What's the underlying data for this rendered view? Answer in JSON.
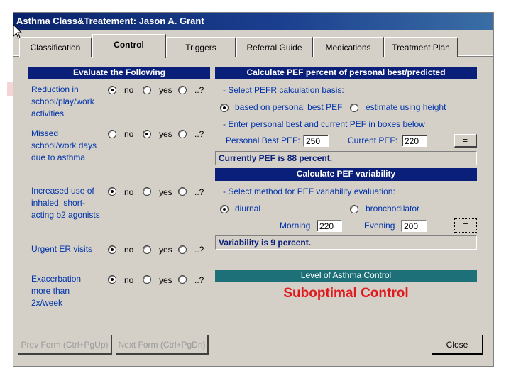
{
  "window": {
    "title": "Asthma Class&Treatement:  Jason A. Grant"
  },
  "tabs": [
    "Classification",
    "Control",
    "Triggers",
    "Referral Guide",
    "Medications",
    "Treatment Plan"
  ],
  "active_tab": "Control",
  "evaluate": {
    "header": "Evaluate the Following",
    "option_labels": {
      "no": "no",
      "yes": "yes",
      "unknown": "..?"
    },
    "items": [
      {
        "label": "Reduction in school/play/work activities",
        "selected": "no"
      },
      {
        "label": "Missed school/work days due to asthma",
        "selected": "yes"
      },
      {
        "label": "Increased use of inhaled, short-acting b2 agonists",
        "selected": "no"
      },
      {
        "label": "Urgent ER visits",
        "selected": "no"
      },
      {
        "label": "Exacerbation more than 2x/week",
        "selected": "no"
      }
    ]
  },
  "pef_percent": {
    "header": "Calculate PEF percent of personal best/predicted",
    "basis_prompt": "- Select PEFR calculation basis:",
    "basis_options": [
      "based on personal best PEF",
      "estimate using height"
    ],
    "basis_selected": "based on personal best PEF",
    "enter_prompt": "- Enter personal best and current PEF in boxes below",
    "personal_best_label": "Personal Best PEF:",
    "personal_best_value": "250",
    "current_label": "Current PEF:",
    "current_value": "220",
    "calc_button": "=",
    "result": "Currently PEF is 88 percent."
  },
  "pef_variability": {
    "header": "Calculate PEF variability",
    "method_prompt": "- Select method for PEF variability evaluation:",
    "method_options": [
      "diurnal",
      "bronchodilator"
    ],
    "method_selected": "diurnal",
    "morning_label": "Morning",
    "morning_value": "220",
    "evening_label": "Evening",
    "evening_value": "200",
    "calc_button": "=",
    "result": "Variability is 9 percent."
  },
  "control_level": {
    "header": "Level of Asthma Control",
    "status": "Suboptimal Control"
  },
  "footer": {
    "prev": "Prev Form (Ctrl+PgUp)",
    "next": "Next Form (Ctrl+PgDn)",
    "close": "Close"
  },
  "colors": {
    "header_navy": "#0a1f7a",
    "label_blue": "#0033aa",
    "teal": "#1d6f78",
    "status_red": "#e0191c"
  }
}
